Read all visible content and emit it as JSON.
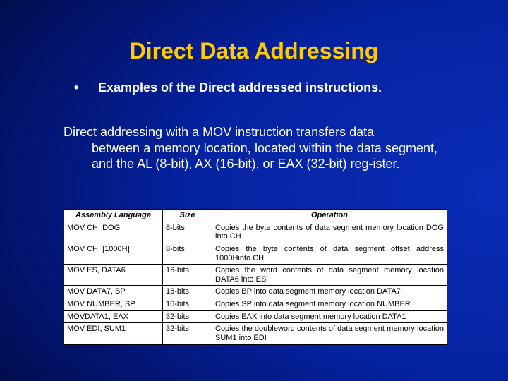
{
  "title": "Direct Data Addressing",
  "bullet_marker": "•",
  "bullet_text": "Examples of the Direct addressed instructions.",
  "body_first": "Direct addressing with a MOV instruction transfers data",
  "body_rest": "between a memory location, located within the data segment, and the AL (8-bit), AX (16-bit), or EAX (32-bit) reg-ister.",
  "table": {
    "headers": [
      "Assembly Language",
      "Size",
      "Operation"
    ],
    "rows": [
      {
        "asm": "MOV CH, DOG",
        "size": "8-bits",
        "op": "Copies the byte contents of data segment memory location DOG into CH"
      },
      {
        "asm": "MOV CH. [1000H]",
        "size": "8-bits",
        "op": "Copies the byte contents of data segment offset address 1000Hinto.CH"
      },
      {
        "asm": "MOV ES, DATA6",
        "size": "16-bits",
        "op": "Copies the word contents of data segment memory location DATA6 into ES"
      },
      {
        "asm": "MOV DATA7, BP",
        "size": "16-bits",
        "op": "Copies BP into data segment memory location DATA7"
      },
      {
        "asm": "MOV NUMBER, SP",
        "size": "16-bits",
        "op": "Copies SP into data segment memory location NUMBER"
      },
      {
        "asm": "MOVDATA1, EAX",
        "size": "32-bits",
        "op": "Copies EAX into data segment memory location DATA1"
      },
      {
        "asm": "MOV EDI, SUM1",
        "size": "32-bits",
        "op": "Copies the doubleword contents of data segment memory location SUM1 into EDI"
      }
    ]
  }
}
